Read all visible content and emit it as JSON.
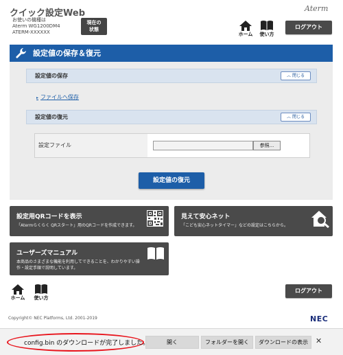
{
  "header": {
    "title": "クイック設定Web",
    "device_label": "お使いの機種は",
    "device_model": "Aterm WG1200DM4",
    "device_sub": "ATERM-XXXXXX",
    "status_button": [
      "現在の",
      "状態"
    ],
    "brand": "Aterm",
    "home_label": "ホーム",
    "howto_label": "使い方",
    "logout_label": "ログアウト"
  },
  "main": {
    "section_title": "設定値の保存＆復元",
    "save_section": {
      "title": "設定値の保存",
      "close_label": "閉じる",
      "link_label": "ファイルへ保存"
    },
    "restore_section": {
      "title": "設定値の復元",
      "close_label": "閉じる",
      "file_label": "設定ファイル",
      "browse_label": "参照...",
      "file_value": ""
    },
    "restore_button": "設定値の復元"
  },
  "tiles": {
    "qr": {
      "title": "設定用QRコードを表示",
      "desc": "「Atermらくらく QRスタート」用のQRコードを作成できます。"
    },
    "safe_net": {
      "title": "見えて安心ネット",
      "desc": "「こども安心ネットタイマー」などの設定はこちらから。"
    },
    "manual": {
      "title": "ユーザーズマニュアル",
      "desc_line1": "本商品のさまざまな機能を利用してできることを、わかりやすい操",
      "desc_line2": "作・設定手順で説明しています。"
    }
  },
  "footer": {
    "home_label": "ホーム",
    "howto_label": "使い方",
    "logout_label": "ログアウト",
    "copyright": "Copyright© NEC Platforms, Ltd. 2001-2019",
    "logo": "NEC"
  },
  "download_bar": {
    "message": "config.bin のダウンロードが完了しました。",
    "open_label": "開く",
    "open_folder_label": "フォルダーを開く",
    "show_downloads_label": "ダウンロードの表示",
    "close_symbol": "✕"
  },
  "colors": {
    "primary_blue": "#1d5ea8",
    "tile_gray": "#4a4a4a",
    "highlight_red": "#e8141c"
  }
}
